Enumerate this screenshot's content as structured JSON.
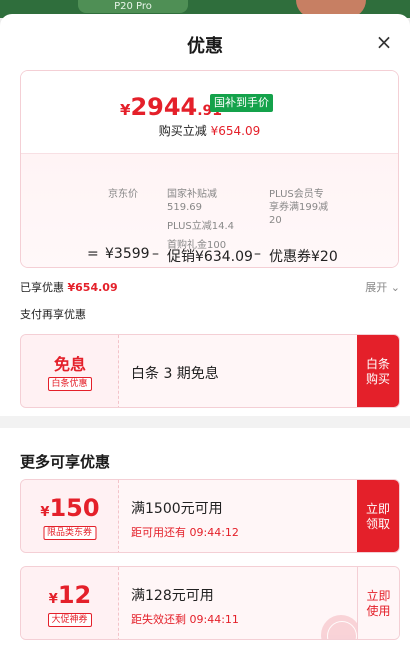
{
  "background": {
    "model_tag": "P20 Pro"
  },
  "header": {
    "title": "优惠",
    "close": "×"
  },
  "price": {
    "currency": "¥",
    "integer": "2944",
    "decimal": ".91",
    "badge": "国补到手价",
    "reduce_label": "购买立减",
    "reduce_amount": "¥654.09",
    "formula": {
      "eq": "=",
      "jd_price": "¥3599",
      "minus1": "–",
      "promo": "促销¥634.09",
      "minus2": "–",
      "coupon": "优惠券¥20",
      "jd_label": "京东价",
      "promo_detail_1": "国家补贴减",
      "promo_detail_1b": "519.69",
      "promo_detail_2": "PLUS立减14.4",
      "promo_detail_3": "首购礼金100",
      "coupon_detail_1": "PLUS会员专",
      "coupon_detail_2": "享券满199减",
      "coupon_detail_3": "20"
    }
  },
  "enjoyed": {
    "label": "已享优惠",
    "amount": "¥654.09",
    "expand": "展开"
  },
  "pay_more": {
    "label": "支付再享优惠"
  },
  "coupon_interest_free": {
    "big": "免息",
    "tag": "白条优惠",
    "title": "白条 3 期免息",
    "button_line1": "白条",
    "button_line2": "购买"
  },
  "more": {
    "title": "更多可享优惠"
  },
  "coupon_150": {
    "currency": "¥",
    "value": "150",
    "tag": "限品类东券",
    "title": "满1500元可用",
    "sub": "距可用还有 09:44:12",
    "button_line1": "立即",
    "button_line2": "领取"
  },
  "coupon_12": {
    "currency": "¥",
    "value": "12",
    "tag": "大促神券",
    "title": "满128元可用",
    "sub": "距失效还剩 09:44:11",
    "button_line1": "立即",
    "button_line2": "使用"
  },
  "colors": {
    "accent_red": "#e4202a",
    "gov_green": "#14a24b"
  }
}
